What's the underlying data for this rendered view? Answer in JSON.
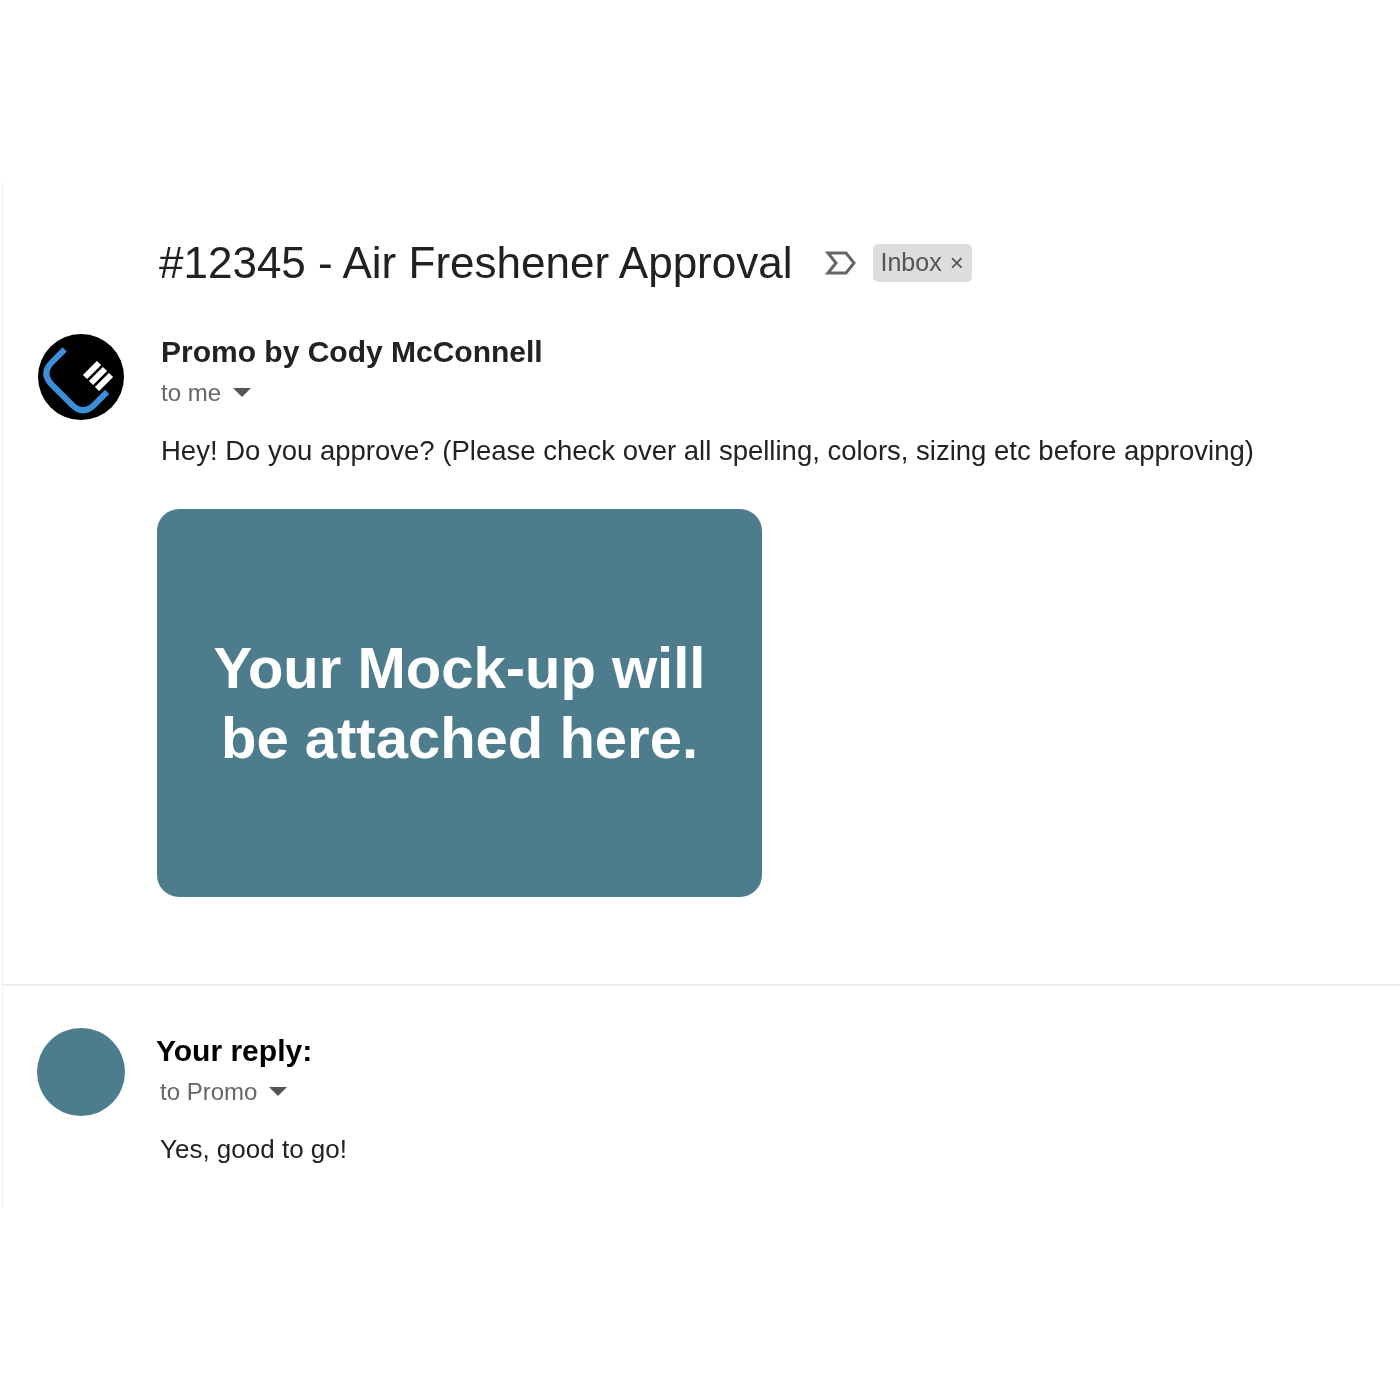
{
  "subject": "#12345 - Air Freshener Approval",
  "label": {
    "text": "Inbox",
    "remove": "×"
  },
  "message": {
    "sender": "Promo by Cody McConnell",
    "recipient": "to me",
    "body": "Hey! Do you approve? (Please check over all spelling, colors, sizing etc before approving)",
    "attachment": {
      "text_lines": [
        "Your Mock-up will",
        "be attached here."
      ]
    }
  },
  "reply": {
    "heading": "Your reply:",
    "recipient": "to Promo",
    "body": "Yes, good to go!"
  }
}
